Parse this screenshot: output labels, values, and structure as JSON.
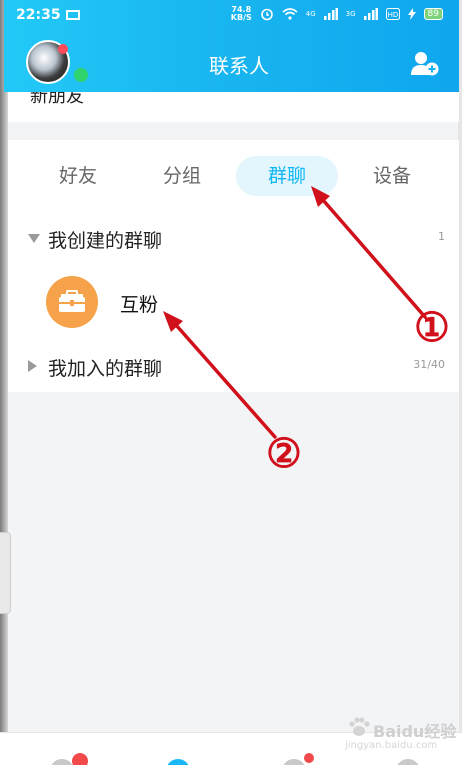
{
  "status_bar": {
    "time": "22:35",
    "speed_value": "74.8",
    "speed_unit": "KB/S",
    "net1": "4G",
    "net2": "3G",
    "battery": "89"
  },
  "header": {
    "title": "联系人"
  },
  "previous_item": {
    "label": "新朋友"
  },
  "tabs": [
    {
      "label": "好友",
      "active": false
    },
    {
      "label": "分组",
      "active": false
    },
    {
      "label": "群聊",
      "active": true
    },
    {
      "label": "设备",
      "active": false
    }
  ],
  "groups": {
    "created": {
      "label": "我创建的群聊",
      "count": "1",
      "items": [
        {
          "name": "互粉"
        }
      ]
    },
    "joined": {
      "label": "我加入的群聊",
      "count": "31/40"
    }
  },
  "annotations": {
    "marker1": "①",
    "marker2": "②"
  },
  "watermark": {
    "title": "Baidu经验",
    "subtitle": "jingyan.baidu.com"
  },
  "colors": {
    "accent": "#12b7f5",
    "header_start": "#22c9f7",
    "header_end": "#0fa6ee",
    "annotation": "#d0101a",
    "group_avatar": "#f5a24b"
  }
}
